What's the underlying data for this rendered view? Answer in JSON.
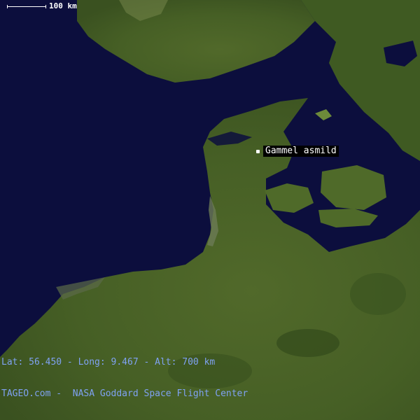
{
  "map": {
    "marker": {
      "label": "Gammel asmild"
    },
    "scale": {
      "label": "100 km"
    },
    "coords": {
      "text": "Lat: 56.450 - Long: 9.467 - Alt: 700 km"
    },
    "credit": {
      "text": "TAGEO.com -  NASA Goddard Space Flight Center"
    },
    "colors": {
      "sea": "#0c0e3d",
      "land": "#465f25",
      "label_bg": "#000000",
      "footer_text": "#7fa2f2"
    }
  }
}
